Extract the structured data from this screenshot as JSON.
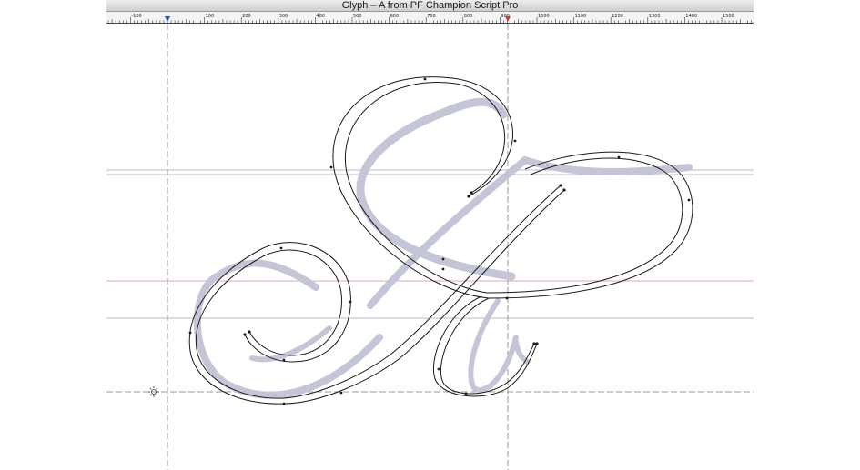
{
  "window": {
    "title": "Glyph – A from PF Champion Script Pro"
  },
  "ruler": {
    "labels": [
      "-100",
      "100",
      "200",
      "300",
      "400",
      "500",
      "600",
      "700",
      "800",
      "900",
      "1000",
      "1100",
      "1200",
      "1300",
      "1400",
      "1500"
    ],
    "markers": {
      "left_sidebearing_color": "#2a4fa8",
      "right_sidebearing_color": "#c83a2a"
    }
  },
  "canvas": {
    "origin_marker_icon": "origin-sun-icon",
    "colors": {
      "metric_line": "#b9b9c9",
      "red_metric_line": "#e4a6b4",
      "sidebearing_line": "#9a9a9a",
      "background_glyph": "#c4c5d6",
      "outline": "#1a1a1a"
    }
  }
}
